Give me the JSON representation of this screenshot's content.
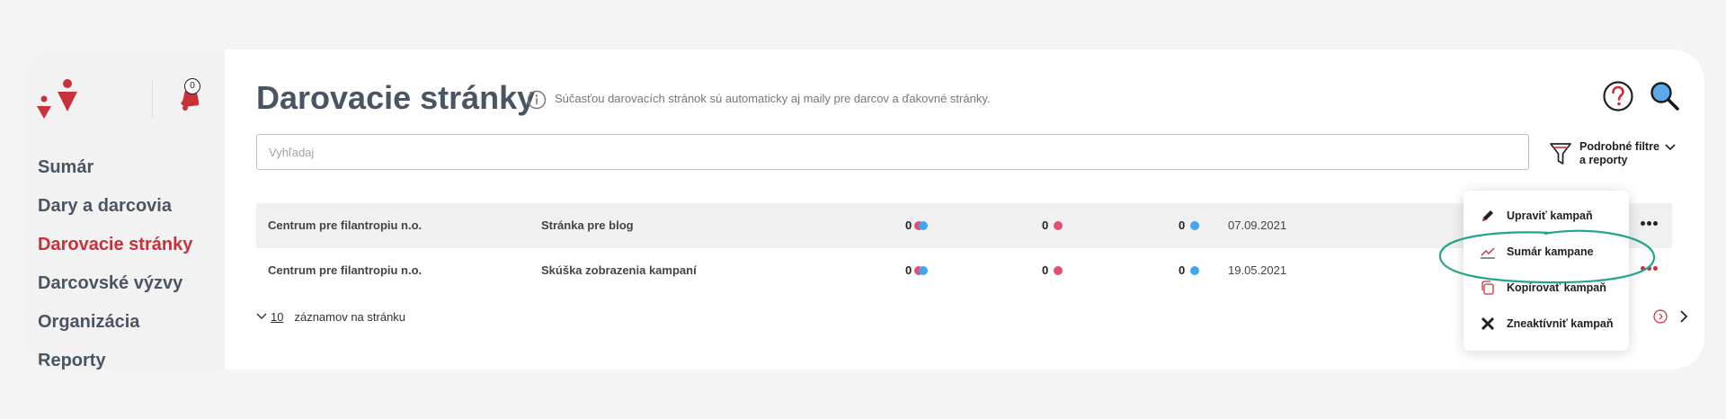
{
  "sidebar": {
    "notification_count": "0",
    "items": [
      {
        "label": "Sumár"
      },
      {
        "label": "Dary a darcovia"
      },
      {
        "label": "Darovacie stránky"
      },
      {
        "label": "Darcovské výzvy"
      },
      {
        "label": "Organizácia"
      },
      {
        "label": "Reporty"
      }
    ],
    "active_index": 2
  },
  "header": {
    "title": "Darovacie stránky",
    "subtitle": "Súčasťou darovacích stránok sú automaticky aj maily pre darcov a ďakovné stránky.",
    "icons": [
      "info-icon",
      "help-icon",
      "search-icon"
    ]
  },
  "search": {
    "placeholder": "Vyhľadaj",
    "value": ""
  },
  "filters": {
    "label_line1": "Podrobné filtre",
    "label_line2": "a reporty"
  },
  "table": {
    "rows": [
      {
        "organization": "Centrum pre filantropiu n.o.",
        "page": "Stránka pre blog",
        "count1": "0",
        "count2": "0",
        "count3": "0",
        "date": "07.09.2021"
      },
      {
        "organization": "Centrum pre filantropiu n.o.",
        "page": "Skúška zobrazenia kampaní",
        "count1": "0",
        "count2": "0",
        "count3": "0",
        "date": "19.05.2021"
      }
    ]
  },
  "pagination": {
    "per_page": "10",
    "per_page_label": "záznamov na stránku"
  },
  "menu": {
    "items": [
      {
        "label": "Upraviť kampaň",
        "icon": "pencil-icon"
      },
      {
        "label": "Sumár kampane",
        "icon": "chart-line-icon"
      },
      {
        "label": "Kopírovať kampaň",
        "icon": "copy-icon"
      },
      {
        "label": "Zneaktívniť kampaň",
        "icon": "close-icon"
      }
    ]
  },
  "colors": {
    "accent": "#c8303a",
    "nav_text": "#4a5563",
    "dot_red": "#e44e72",
    "dot_blue": "#42a6ee",
    "annotation": "#23a58a"
  }
}
